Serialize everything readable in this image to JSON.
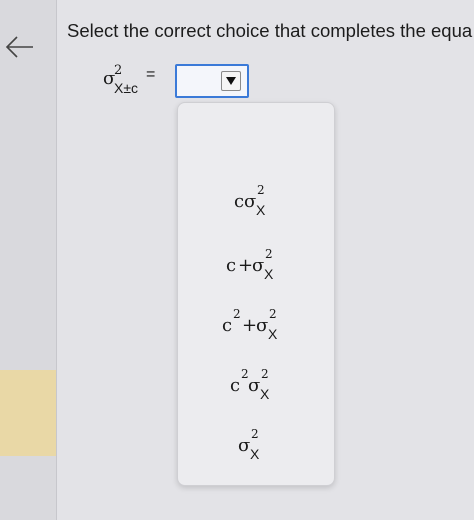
{
  "prompt": {
    "text": "Select the correct choice that completes the equa"
  },
  "expression": {
    "symbol": "σ",
    "exponent": "2",
    "subscript": "X±c",
    "equals": "="
  },
  "select": {
    "value": "",
    "accent_color": "#3b7ad8"
  },
  "options": [
    {
      "c": "c",
      "sigma": "σ",
      "exp": "2",
      "sub": "X"
    },
    {
      "c": "c",
      "plus": "+",
      "sigma": "σ",
      "exp": "2",
      "sub": "X"
    },
    {
      "c": "c",
      "cexp": "2",
      "plus": "+",
      "sigma": "σ",
      "exp": "2",
      "sub": "X"
    },
    {
      "c": "c",
      "cexp": "2",
      "sigma": "σ",
      "exp": "2",
      "sub": "X"
    },
    {
      "sigma": "σ",
      "exp": "2",
      "sub": "X"
    }
  ],
  "icons": {
    "back": "back-arrow-icon",
    "dropdown": "dropdown-triangle-icon"
  },
  "colors": {
    "highlight": "#e9d8a6"
  }
}
